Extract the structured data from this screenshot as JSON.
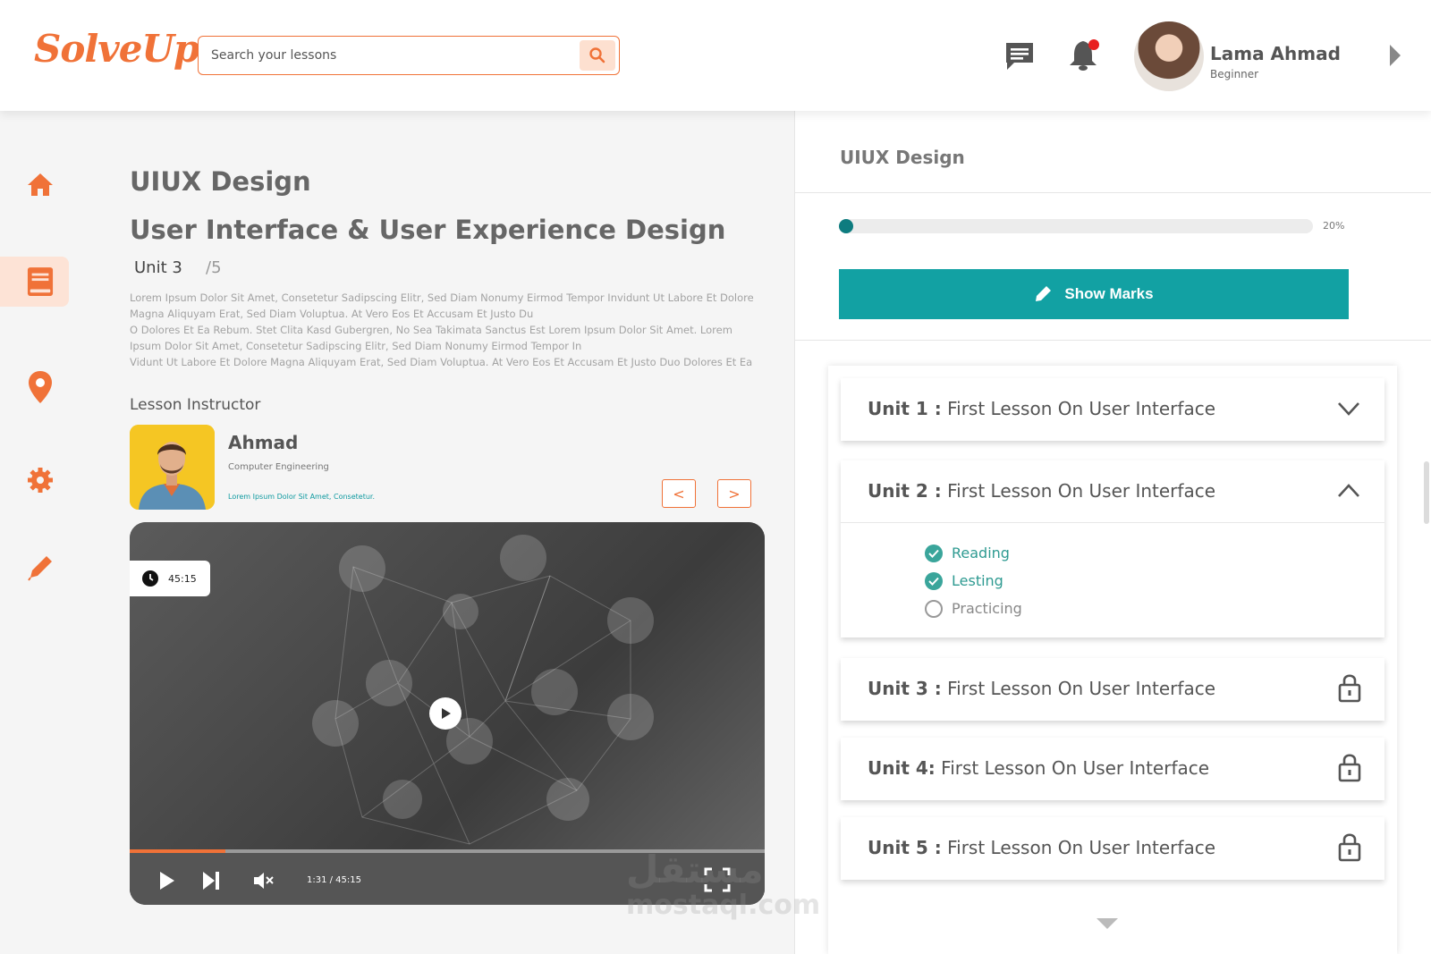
{
  "brand": {
    "logo_text": "SolveUp",
    "accent": "#f07238",
    "teal": "#12a1a3"
  },
  "search": {
    "placeholder": "Search your lessons"
  },
  "header": {
    "icons": [
      "chat-icon",
      "bell-icon"
    ],
    "user": {
      "name": "Lama Ahmad",
      "level": "Beginner"
    }
  },
  "sidebar": {
    "items": [
      "home-icon",
      "book-icon",
      "location-pin-icon",
      "gear-icon",
      "pen-icon"
    ],
    "active_index": 1
  },
  "course": {
    "title": "UIUX Design",
    "subtitle": "User Interface & User Experience Design",
    "unit_current": "Unit 3",
    "unit_total": "/5",
    "description_lines": [
      "Lorem Ipsum Dolor Sit Amet, Consetetur Sadipscing Elitr, Sed Diam Nonumy Eirmod Tempor Invidunt Ut Labore Et Dolore",
      "Magna Aliquyam Erat, Sed Diam Voluptua. At Vero Eos Et Accusam Et Justo Du",
      "O Dolores Et Ea Rebum. Stet Clita Kasd Gubergren, No Sea Takimata Sanctus Est Lorem Ipsum Dolor Sit Amet. Lorem",
      "Ipsum Dolor Sit Amet, Consetetur Sadipscing Elitr, Sed Diam Nonumy Eirmod Tempor In",
      "Vidunt Ut Labore Et Dolore Magna Aliquyam Erat, Sed Diam Voluptua. At Vero Eos Et Accusam Et Justo Duo Dolores Et Ea"
    ]
  },
  "instructor": {
    "label": "Lesson Instructor",
    "name": "Ahmad",
    "field": "Computer Engineering",
    "note": "Lorem Ipsum Dolor Sit Amet, Consetetur.",
    "prev_label": "<",
    "next_label": ">"
  },
  "video": {
    "duration_badge": "45:15",
    "time_display": "1:31 / 45:15",
    "progress_fraction": 0.15
  },
  "panel": {
    "title": "UIUX Design",
    "progress_percent": 20,
    "progress_label": "20%",
    "show_marks_label": "Show Marks",
    "units": [
      {
        "prefix": "Unit 1 :",
        "title": "First Lesson On User Interface",
        "state": "collapsed"
      },
      {
        "prefix": "Unit 2 :",
        "title": "First Lesson On User Interface",
        "state": "expanded",
        "items": [
          {
            "label": "Reading",
            "done": true
          },
          {
            "label": "Lesting",
            "done": true
          },
          {
            "label": "Practicing",
            "done": false
          }
        ]
      },
      {
        "prefix": "Unit 3 :",
        "title": "First Lesson On User Interface",
        "state": "locked"
      },
      {
        "prefix": "Unit 4:",
        "title": "First Lesson On User Interface",
        "state": "locked"
      },
      {
        "prefix": "Unit 5 :",
        "title": "First Lesson On User Interface",
        "state": "locked"
      }
    ]
  },
  "watermark": {
    "arabic": "مستقل",
    "latin": "mostaql.com"
  }
}
